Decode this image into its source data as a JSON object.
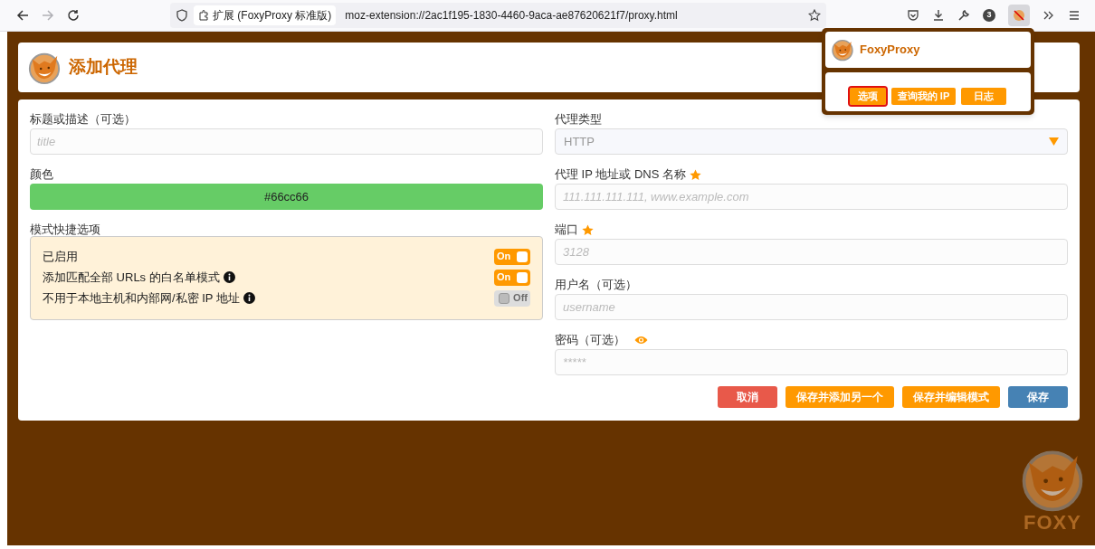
{
  "browser": {
    "identity_label": "扩展 (FoxyProxy 标准版)",
    "url": "moz-extension://2ac1f195-1830-4460-9aca-ae87620621f7/proxy.html",
    "forward_disabled": true,
    "extension_badge": "3"
  },
  "header": {
    "title": "添加代理"
  },
  "popup": {
    "title": "FoxyProxy",
    "buttons": [
      {
        "label": "选项",
        "outlined": true
      },
      {
        "label": "查询我的 IP",
        "outlined": false
      },
      {
        "label": "日志",
        "outlined": false
      }
    ]
  },
  "left": {
    "title_field": {
      "label": "标题或描述（可选）",
      "placeholder": "title"
    },
    "color_field": {
      "label": "颜色",
      "value": "#66cc66"
    },
    "quick_options": {
      "label": "模式快捷选项",
      "items": [
        {
          "label": "已启用",
          "info": false,
          "on": true,
          "toggle_text": "On"
        },
        {
          "label": "添加匹配全部 URLs 的白名单模式",
          "info": true,
          "on": true,
          "toggle_text": "On"
        },
        {
          "label": "不用于本地主机和内部网/私密 IP 地址",
          "info": true,
          "on": false,
          "toggle_text": "Off"
        }
      ]
    }
  },
  "right": {
    "proxy_type": {
      "label": "代理类型",
      "value": "HTTP"
    },
    "fields": [
      {
        "label": "代理 IP 地址或 DNS 名称",
        "required": true,
        "reveal": false,
        "placeholder": "111.111.111.111, www.example.com"
      },
      {
        "label": "端口",
        "required": true,
        "reveal": false,
        "placeholder": "3128"
      },
      {
        "label": "用户名（可选）",
        "required": false,
        "reveal": false,
        "placeholder": "username"
      },
      {
        "label": "密码（可选）",
        "required": false,
        "reveal": true,
        "placeholder": "*****"
      }
    ]
  },
  "buttons": [
    {
      "label": "取消",
      "kind": "danger"
    },
    {
      "label": "保存并添加另一个",
      "kind": "warning"
    },
    {
      "label": "保存并编辑模式",
      "kind": "warning"
    },
    {
      "label": "保存",
      "kind": "primary"
    }
  ],
  "footer_logo": {
    "wordmark": "FOXY"
  }
}
